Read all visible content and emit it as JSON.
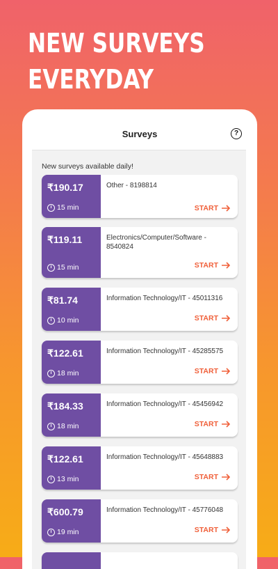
{
  "headline": {
    "line1": "NEW SURVEYS",
    "line2": "EVERYDAY"
  },
  "appbar": {
    "title": "Surveys",
    "help_icon": "help-icon"
  },
  "subtitle": "New surveys available daily!",
  "start_label": "START",
  "colors": {
    "card_accent": "#6f4ea3",
    "start_text": "#f0603a"
  },
  "surveys": [
    {
      "amount": "₹190.17",
      "duration": "15 min",
      "name": "Other - 8198814"
    },
    {
      "amount": "₹119.11",
      "duration": "15 min",
      "name": "Electronics/Computer/Software - 8540824"
    },
    {
      "amount": "₹81.74",
      "duration": "10 min",
      "name": "Information Technology/IT - 45011316"
    },
    {
      "amount": "₹122.61",
      "duration": "18 min",
      "name": "Information Technology/IT - 45285575"
    },
    {
      "amount": "₹184.33",
      "duration": "18 min",
      "name": "Information Technology/IT - 45456942"
    },
    {
      "amount": "₹122.61",
      "duration": "13 min",
      "name": "Information Technology/IT - 45648883"
    },
    {
      "amount": "₹600.79",
      "duration": "19 min",
      "name": "Information Technology/IT - 45776048"
    }
  ]
}
